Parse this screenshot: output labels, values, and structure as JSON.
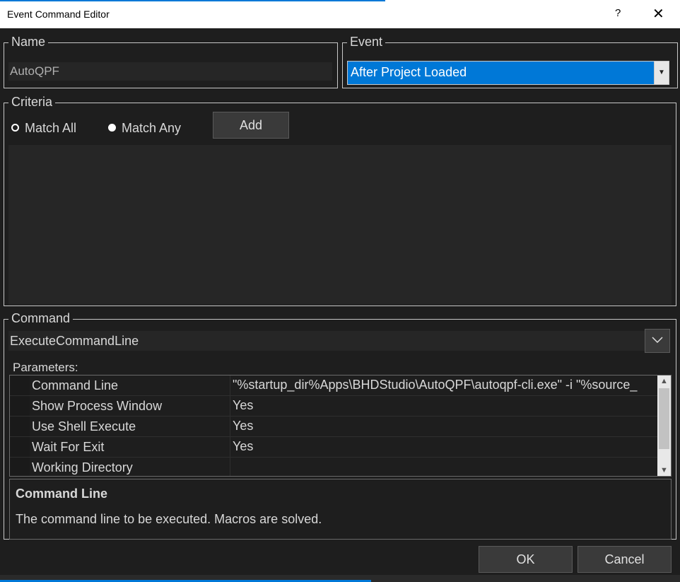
{
  "window": {
    "title": "Event Command Editor",
    "help_label": "?",
    "close_label": "✕"
  },
  "name_group": {
    "legend": "Name",
    "value": "AutoQPF"
  },
  "event_group": {
    "legend": "Event",
    "selected": "After Project Loaded"
  },
  "criteria": {
    "legend": "Criteria",
    "match_all": "Match All",
    "match_any": "Match Any",
    "selected_mode": "Match Any",
    "add_label": "Add"
  },
  "command": {
    "legend": "Command",
    "selected": "ExecuteCommandLine",
    "parameters_label": "Parameters:",
    "parameters": [
      {
        "name": "Command Line",
        "value": "\"%startup_dir%Apps\\BHDStudio\\AutoQPF\\autoqpf-cli.exe\" -i \"%source_"
      },
      {
        "name": "Show Process Window",
        "value": "Yes"
      },
      {
        "name": "Use Shell Execute",
        "value": "Yes"
      },
      {
        "name": "Wait For Exit",
        "value": "Yes"
      },
      {
        "name": "Working Directory",
        "value": ""
      }
    ],
    "description_title": "Command Line",
    "description_text": "The command line to be executed. Macros are solved."
  },
  "buttons": {
    "ok": "OK",
    "cancel": "Cancel"
  },
  "icons": {
    "dropdown": "chevron-down-icon",
    "scroll_up": "scroll-up-icon",
    "scroll_down": "scroll-down-icon"
  },
  "colors": {
    "accent": "#0078d7",
    "background": "#1e1e1e"
  }
}
